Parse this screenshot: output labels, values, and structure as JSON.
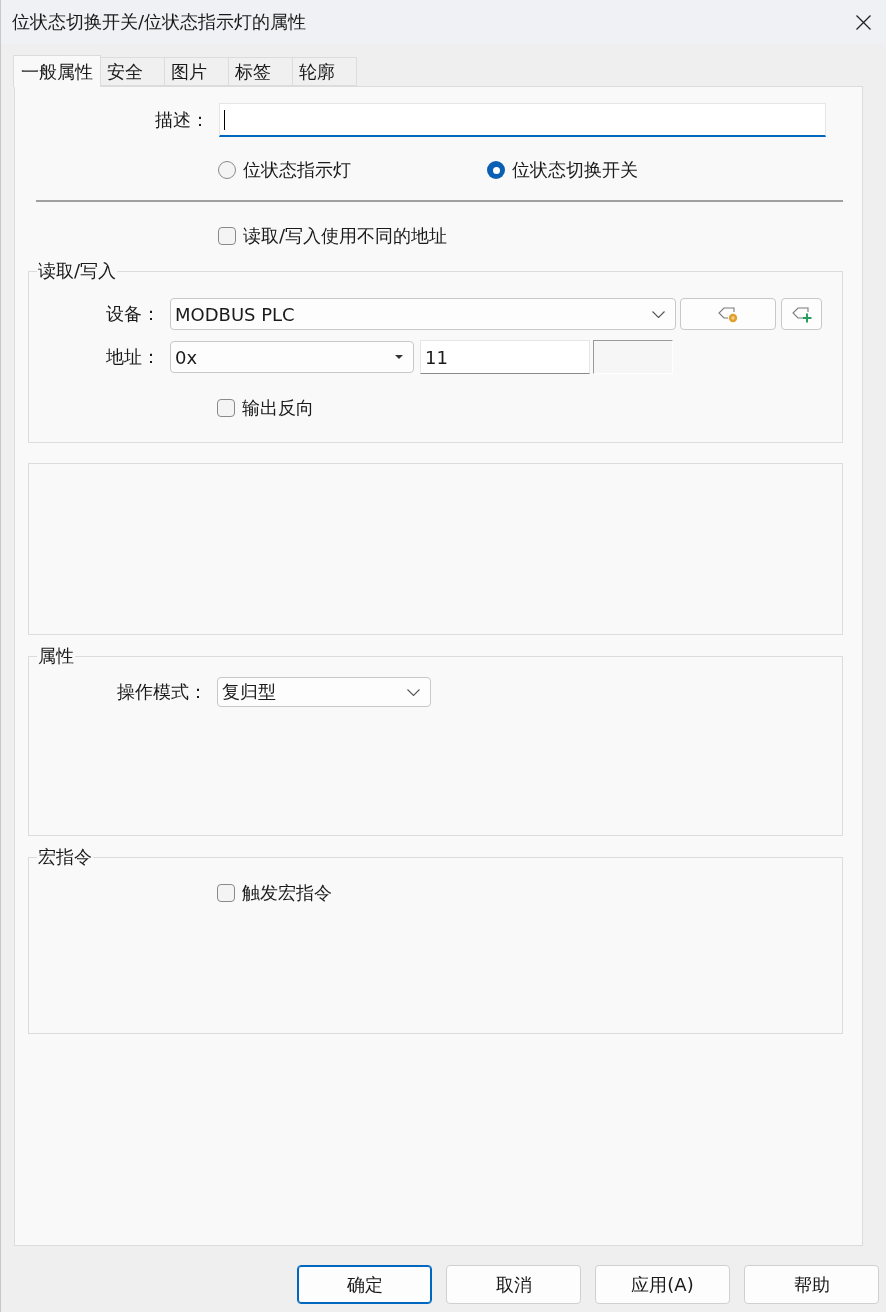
{
  "window": {
    "title": "位状态切换开关/位状态指示灯的属性"
  },
  "tabs": [
    {
      "label": "一般属性",
      "selected": true
    },
    {
      "label": "安全",
      "selected": false
    },
    {
      "label": "图片",
      "selected": false
    },
    {
      "label": "标签",
      "selected": false
    },
    {
      "label": "轮廓",
      "selected": false
    }
  ],
  "description": {
    "label": "描述：",
    "focused": true
  },
  "indicator_type": [
    {
      "label": "位状态指示灯",
      "selected": false
    },
    {
      "label": "位状态切换开关",
      "selected": true
    }
  ],
  "separate_addresses": {
    "label": "读取/写入使用不同的地址",
    "checked": false
  },
  "read_write": {
    "legend": "读取/写入",
    "device": {
      "label": "设备：",
      "value": "MODBUS PLC"
    },
    "address": {
      "label": "地址：",
      "type": "0x",
      "value": "11"
    },
    "invert_output": {
      "label": "输出反向",
      "checked": false
    }
  },
  "attributes": {
    "legend": "属性",
    "operation_mode": {
      "label": "操作模式：",
      "value": "复归型"
    }
  },
  "macro": {
    "legend": "宏指令",
    "trigger": {
      "label": "触发宏指令",
      "checked": false
    }
  },
  "buttons": [
    {
      "label": "确定",
      "default": true
    },
    {
      "label": "取消",
      "default": false
    },
    {
      "label": "应用(A)",
      "default": false
    },
    {
      "label": "帮助",
      "default": false
    }
  ]
}
